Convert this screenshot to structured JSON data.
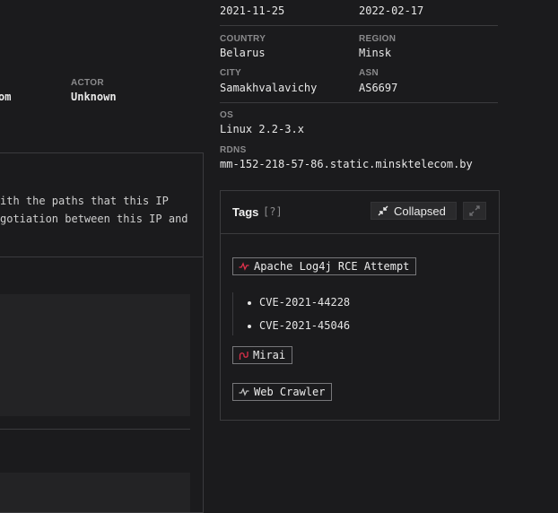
{
  "top": {
    "first_seen": "2021-11-25",
    "last_seen": "2022-02-17"
  },
  "geo": {
    "country_label": "COUNTRY",
    "country": "Belarus",
    "region_label": "REGION",
    "region": "Minsk",
    "city_label": "CITY",
    "city": "Samakhvalavichy",
    "asn_label": "ASN",
    "asn": "AS6697",
    "os_label": "OS",
    "os": "Linux 2.2-3.x",
    "rdns_label": "RDNS",
    "rdns": "mm-152-218-57-86.static.minsktelecom.by"
  },
  "left": {
    "org_fragment": "om",
    "actor_label": "ACTOR",
    "actor": "Unknown",
    "desc_line1": "ith the paths that this IP",
    "desc_line2": "gotiation between this IP and"
  },
  "tags_card": {
    "title": "Tags",
    "help": "[?]",
    "collapsed_label": "Collapsed",
    "tags": [
      {
        "label": "Apache Log4j RCE Attempt",
        "icon": "malicious-activity-icon",
        "color": "#e0314b"
      },
      {
        "label": "Mirai",
        "icon": "malicious-worm-icon",
        "color": "#e0314b"
      },
      {
        "label": "Web Crawler",
        "icon": "activity-icon",
        "color": "#bdbdbd"
      }
    ],
    "cves": [
      "CVE-2021-44228",
      "CVE-2021-45046"
    ]
  }
}
